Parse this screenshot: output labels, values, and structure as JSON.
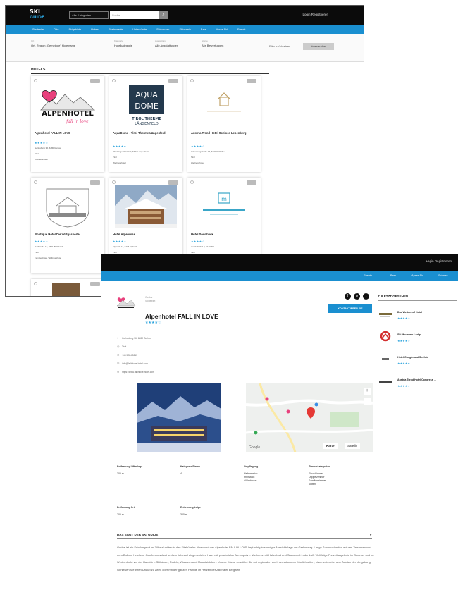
{
  "back": {
    "brand": {
      "line1": "SKI",
      "line2": "GUIDE"
    },
    "header": {
      "select_label": "Alle Kategorien",
      "search_placeholder": "Suche",
      "search_button": "⌕",
      "login": "Login  Registrieren"
    },
    "nav": [
      "Startseite",
      "Orte",
      "Skigebiete",
      "Hotels",
      "Restaurants",
      "Unterkünfte",
      "Skischulen",
      "Skiverleih",
      "Bars",
      "Apres Ski",
      "Events"
    ],
    "filters": [
      {
        "label": "Ort",
        "value": "Ort, Region (Gemeinde) Hotelname"
      },
      {
        "label": "Kategorie",
        "value": "Hotelkategorie"
      },
      {
        "label": "Ausstattung",
        "value": "Alle Ausstattungen"
      },
      {
        "label": "Sterne",
        "value": "Alle Bewertungen"
      }
    ],
    "reset_label": "Filter zurücksetzen",
    "search_label": "Hotels suchen",
    "section_title": "HOTELS",
    "cards": [
      {
        "name": "Alpenhotel FALL IN LOVE",
        "stars": "★★★★☆",
        "lines": [
          "Gerlosberg 36, 6280 Gerlos",
          "Tirol",
          "Wellnesshotel"
        ]
      },
      {
        "name": "AquaDome - Tirol Therme Längenfeld",
        "stars": "★★★★★",
        "lines": [
          "Oberlängenfeld 140, 6444 Längenfeld",
          "Tirol",
          "Wellnesshotel"
        ]
      },
      {
        "name": "Austria Trend Hotel Schloss Lebenberg",
        "stars": "★★★★☆",
        "lines": [
          "Lebenbergstraße 17, 6370 Kitzbühel",
          "Tirol",
          "Wellnesshotel"
        ]
      },
      {
        "name": "Boutique Hotel Die Wittgasperle",
        "stars": "★★★★☆",
        "lines": [
          "Dorfstraße 17, 6621 Bichlbach",
          "Tirol",
          "Familienhotel, Wellnesshotel"
        ]
      },
      {
        "name": "Hotel Alpenrose",
        "stars": "★★★★☆",
        "lines": [
          "Alpbach 14, 6236 Alpbach",
          "Tirol",
          "Wellnesshotel"
        ]
      },
      {
        "name": "Hotel Sonnblick",
        "stars": "★★★★☆",
        "lines": [
          "Am Schulhof 3, 6170 Zirl",
          "Tirol",
          "Familienhotel"
        ]
      }
    ],
    "aqua_logo": {
      "l1": "AQUA",
      "l2": "DOME",
      "l3": "TIROL THERME",
      "l4": "LÄNGENFELD"
    },
    "alpen_logo": {
      "l1": "ALPENHOTEL",
      "l2": "fall in love"
    }
  },
  "front": {
    "login": "Login  Registrieren",
    "nav": [
      "Events",
      "Bars",
      "Apres Ski",
      "Schnee"
    ],
    "brand_sub": [
      "Gerlos",
      "Skigebiet"
    ],
    "title": "Alpenhotel FALL IN LOVE",
    "stars": "★★★★☆",
    "contact_button": "KONTAKTIEREN SIE",
    "info": [
      {
        "icon": "⌖",
        "text": "Gerlosberg 36, 6280 Gerlos"
      },
      {
        "icon": "◎",
        "text": "Tirol"
      },
      {
        "icon": "✆",
        "text": "+43 5284 5215"
      },
      {
        "icon": "✉",
        "text": "info@fallinlove-hotel.com"
      },
      {
        "icon": "⊕",
        "text": "https://www.fallinlove-hotel.com"
      }
    ],
    "map": {
      "tab_map": "Karte",
      "tab_sat": "Satellit",
      "zoom_in": "+",
      "zoom_out": "−",
      "google": "Google"
    },
    "details": [
      {
        "head": "Entfernung Liftanlage",
        "vals": [
          "300 m"
        ]
      },
      {
        "head": "Kategorie Sterne",
        "vals": [
          "4"
        ]
      },
      {
        "head": "Verpflegung",
        "vals": [
          "Halbpension",
          "Frühstück",
          "All Inclusive"
        ]
      },
      {
        "head": "Zimmerkategorien",
        "vals": [
          "Einzelzimmer",
          "Doppelzimmer",
          "Familienzimmer",
          "Suiten"
        ]
      },
      {
        "head": "Entfernung Ort",
        "vals": [
          "200 m"
        ]
      },
      {
        "head": "Entfernung Loipe",
        "vals": [
          "300 m"
        ]
      }
    ],
    "section_title": "DAS SAGT DER SKI GUIDE",
    "chevron": "∨",
    "body": "Gerlos ist ein Erholungsort im Zillertal mitten in den Kitzbüheler Alpen und das Alpenhotel FALL IN LOVE liegt ruhig in sonniger Aussichtslage am Gerlosberg. Lange Sonnenstunden auf den Terrassen und dem Balkon, herzliche Gastfreundschaft und ein liebevoll eingerichtetes Haus mit persönlicher Atmosphäre. Wellness mit Hallenbad und Saunawelt in der Luft. Vielfältige Freizeitangebote im Sommer und im Winter direkt vor der Haustür – Skifahren, Rodeln, Wandern und Mountainbiken. Unsere Küche verwöhnt Sie mit regionalen und internationalen Köstlichkeiten, frisch zubereitet aus Zutaten der Umgebung. Genießen Sie Ihren Urlaub zu zweit oder mit der ganzen Familie im Herzen der Zillertaler Bergwelt.",
    "side_title": "ZULETZT GESEHEN",
    "side_items": [
      {
        "name": "Das Weitenhof Hotel",
        "stars": "★★★★☆"
      },
      {
        "name": "Ski Mountain Lodge",
        "stars": "★★★★☆"
      },
      {
        "name": "Hotel Gungimand Seefeld",
        "stars": "★★★★★"
      },
      {
        "name": "Austria Trend Hotel Congress ...",
        "stars": "★★★★☆"
      }
    ]
  },
  "colors": {
    "nav_blue": "#1a8fd0",
    "star_blue": "#2aa3dc",
    "topbar": "#0b0b0b",
    "heart_pink": "#e8417d"
  }
}
